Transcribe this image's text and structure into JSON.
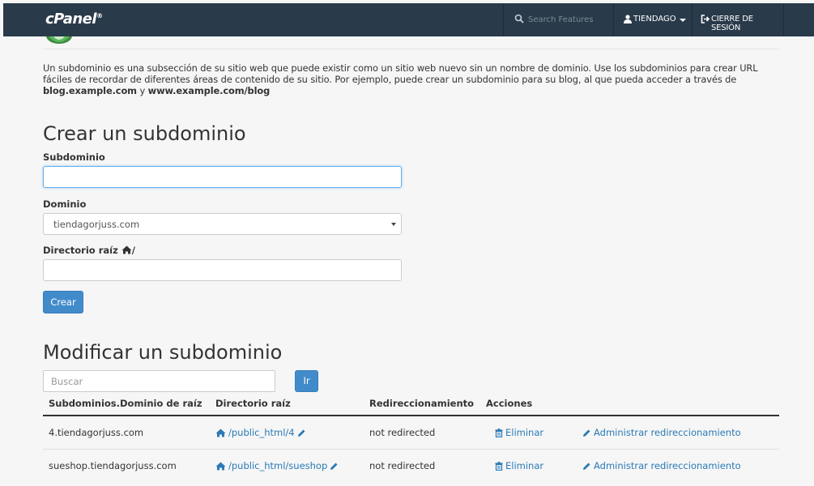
{
  "topbar": {
    "brand": "cPanel",
    "search_placeholder": "Search Features",
    "user": "TIENDAGO",
    "logout": "CIERRE DE SESIÓN"
  },
  "intro": {
    "text": "Un subdominio es una subsección de su sitio web que puede existir como un sitio web nuevo sin un nombre de dominio. Use los subdominios para crear URL fáciles de recordar de diferentes áreas de contenido de su sitio. Por ejemplo, puede crear un subdominio para su blog, al que pueda acceder a través de ",
    "example1": "blog.example.com",
    "conj": " y ",
    "example2": "www.example.com/blog"
  },
  "create": {
    "title": "Crear un subdominio",
    "subdomain_label": "Subdominio",
    "subdomain_value": "",
    "domain_label": "Dominio",
    "domain_value": "tiendagorjuss.com",
    "docroot_label": "Directorio raíz",
    "docroot_suffix": "/",
    "docroot_value": "",
    "button": "Crear"
  },
  "modify": {
    "title": "Modificar un subdominio",
    "search_placeholder": "Buscar",
    "go_button": "Ir",
    "columns": [
      "Subdominios.Dominio de raíz",
      "Directorio raíz",
      "Redireccionamiento",
      "Acciones"
    ],
    "rows": [
      {
        "subdomain": "4.tiendagorjuss.com",
        "docroot": "/public_html/4",
        "redirect": "not redirected",
        "delete": "Eliminar",
        "manage": "Administrar redireccionamiento"
      },
      {
        "subdomain": "sueshop.tiendagorjuss.com",
        "docroot": "/public_html/sueshop",
        "redirect": "not redirected",
        "delete": "Eliminar",
        "manage": "Administrar redireccionamiento"
      }
    ]
  },
  "colors": {
    "topbar": "#293a4a",
    "primary": "#428bca",
    "link": "#2a7ab5"
  },
  "icons": [
    "search-icon",
    "user-icon",
    "logout-icon",
    "home-icon",
    "pencil-icon",
    "trash-icon"
  ]
}
